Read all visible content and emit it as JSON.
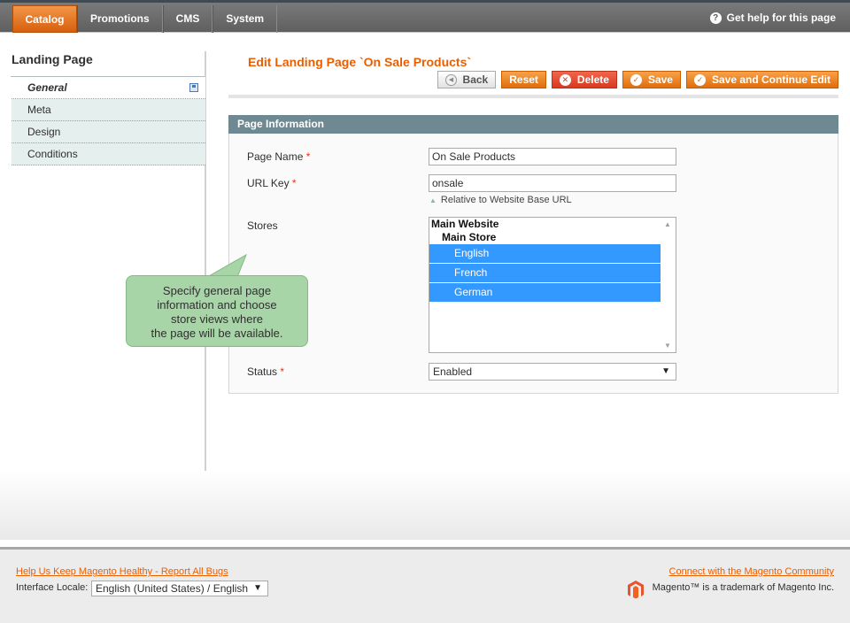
{
  "nav": {
    "items": [
      "Catalog",
      "Promotions",
      "CMS",
      "System"
    ],
    "help": "Get help for this page"
  },
  "sidebar": {
    "title": "Landing Page",
    "tabs": [
      "General",
      "Meta",
      "Design",
      "Conditions"
    ]
  },
  "header": {
    "title": "Edit Landing Page `On Sale Products`",
    "buttons": {
      "back": "Back",
      "reset": "Reset",
      "delete": "Delete",
      "save": "Save",
      "save_continue": "Save and Continue Edit"
    }
  },
  "fieldset": {
    "title": "Page Information",
    "page_name": {
      "label": "Page Name",
      "value": "On Sale Products"
    },
    "url_key": {
      "label": "URL Key",
      "value": "onsale",
      "note": "Relative to Website Base URL"
    },
    "stores": {
      "label": "Stores",
      "website": "Main Website",
      "store": "Main Store",
      "views": [
        "English",
        "French",
        "German"
      ]
    },
    "status": {
      "label": "Status",
      "value": "Enabled"
    },
    "required_mark": "*"
  },
  "tooltip": {
    "lines": [
      "Specify general page",
      "information and choose",
      "store views where",
      "the page will be available."
    ]
  },
  "footer": {
    "bugs_link": "Help Us Keep Magento Healthy - Report All Bugs",
    "locale_label": "Interface Locale:",
    "locale_value": "English (United States) / English",
    "community_link": "Connect with the Magento Community",
    "trademark": "Magento™ is a trademark of Magento Inc."
  },
  "colors": {
    "accent": "#eb5e00",
    "fieldset_header": "#6f8992",
    "selection": "#3399ff",
    "tooltip": "#a8d5a7"
  },
  "icons": [
    "help-icon",
    "save-icon",
    "back-icon",
    "delete-icon",
    "check-icon",
    "magento-logo-icon"
  ]
}
